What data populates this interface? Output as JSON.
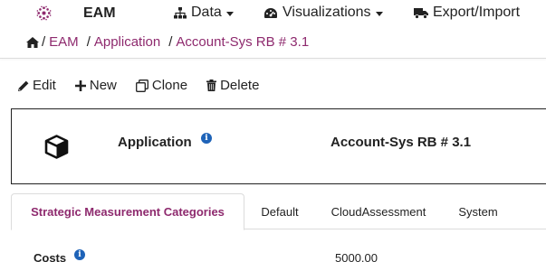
{
  "navbar": {
    "brand": "EAM",
    "brand_color": "#8e2a6e",
    "items": [
      {
        "label": "Data",
        "icon": "sitemap-icon",
        "dropdown": true
      },
      {
        "label": "Visualizations",
        "icon": "tachometer-icon",
        "dropdown": true
      },
      {
        "label": "Export/Import",
        "icon": "truck-icon",
        "dropdown": false
      }
    ]
  },
  "breadcrumb": {
    "home_icon": "home-icon",
    "items": [
      "EAM",
      "Application",
      "Account-Sys RB # 3.1"
    ]
  },
  "toolbar": {
    "edit_label": "Edit",
    "new_label": "New",
    "clone_label": "Clone",
    "delete_label": "Delete"
  },
  "header": {
    "icon": "cube-icon",
    "type_label": "Application",
    "info_glyph": "i",
    "title": "Account-Sys RB # 3.1"
  },
  "tabs": [
    {
      "label": "Strategic Measurement Categories",
      "active": true
    },
    {
      "label": "Default",
      "active": false
    },
    {
      "label": "CloudAssessment",
      "active": false
    },
    {
      "label": "System",
      "active": false
    }
  ],
  "rows": [
    {
      "label": "Costs",
      "info_glyph": "i",
      "value": "5000.00"
    }
  ],
  "colors": {
    "accent": "#8e2a6e",
    "info": "#1e63b8",
    "text": "#222222",
    "border": "#dcdcdc"
  }
}
